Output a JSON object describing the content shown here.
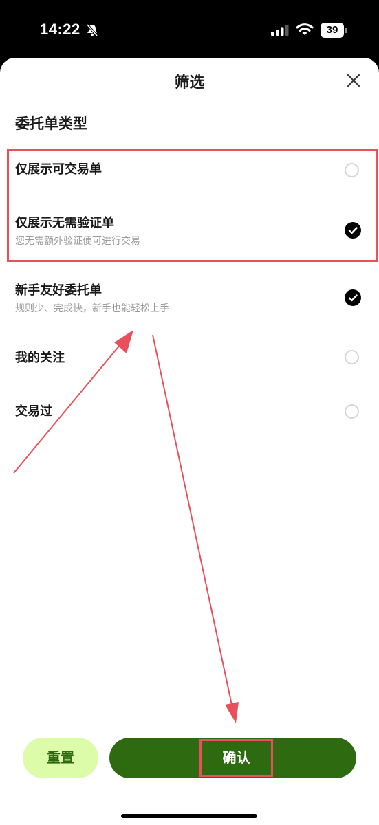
{
  "status_bar": {
    "time": "14:22",
    "battery": "39",
    "icons": [
      "bell-slash-icon",
      "signal-icon",
      "wifi-icon",
      "battery-icon"
    ]
  },
  "sheet": {
    "title": "筛选",
    "close_icon": "close-icon",
    "section_title": "委托单类型",
    "options": [
      {
        "label": "仅展示可交易单",
        "sub": "",
        "checked": false
      },
      {
        "label": "仅展示无需验证单",
        "sub": "您无需额外验证便可进行交易",
        "checked": true
      },
      {
        "label": "新手友好委托单",
        "sub": "规则少、完成快，新手也能轻松上手",
        "checked": true
      },
      {
        "label": "我的关注",
        "sub": "",
        "checked": false
      },
      {
        "label": "交易过",
        "sub": "",
        "checked": false
      }
    ]
  },
  "footer": {
    "reset_label": "重置",
    "confirm_label": "确认"
  },
  "colors": {
    "accent_dark_green": "#2e6b10",
    "accent_light_green": "#dcfcaa",
    "annotation_red": "#e8505b"
  }
}
